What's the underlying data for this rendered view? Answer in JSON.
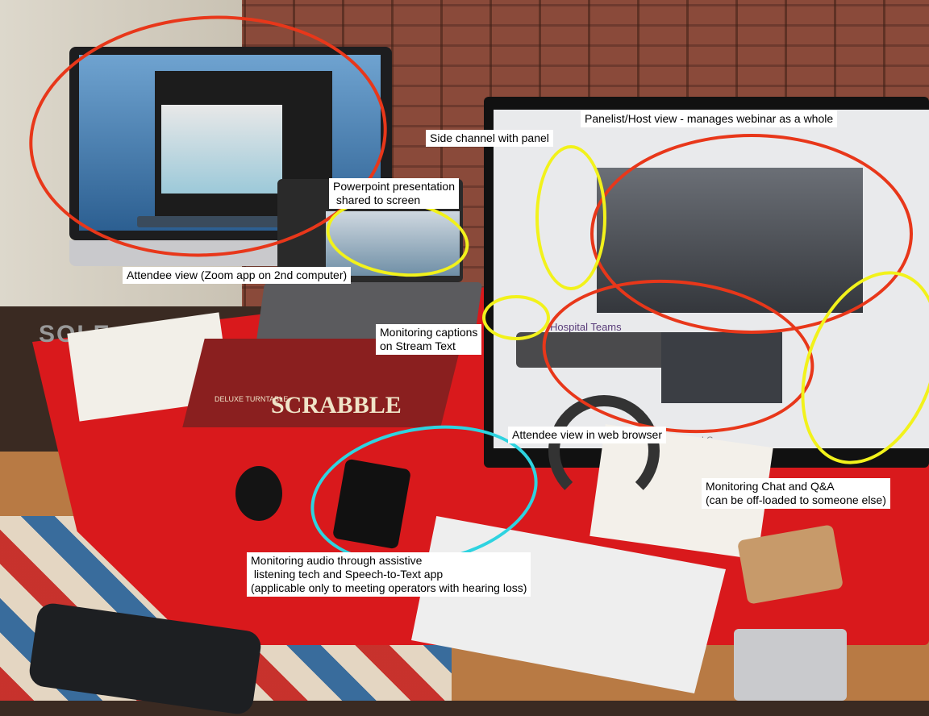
{
  "annotations": {
    "attendee_zoom": "Attendee view (Zoom app on 2nd computer)",
    "powerpoint": "Powerpoint presentation\n shared to screen",
    "side_channel": "Side channel with panel",
    "panelist_host": "Panelist/Host view - manages webinar as a whole",
    "monitoring_captions": "Monitoring captions\non Stream Text",
    "attendee_browser": "Attendee view in web browser",
    "monitoring_chat": "Monitoring Chat and Q&A\n(can be off-loaded to someone else)",
    "monitoring_audio": "Monitoring audio through assistive\n listening tech and Speech-to-Text app\n(applicable only to meeting operators with hearing loss)"
  },
  "scene_text": {
    "scrabble": "SCRABBLE",
    "scrabble_edition": "DELUXE TURNTABLE",
    "sole": "SOLE",
    "lg": "LG",
    "hospital_teams": "Hospital Teams"
  },
  "colors": {
    "red_circle": "#e8371a",
    "yellow_circle": "#f2f21b",
    "cyan_circle": "#2ed3e0"
  }
}
